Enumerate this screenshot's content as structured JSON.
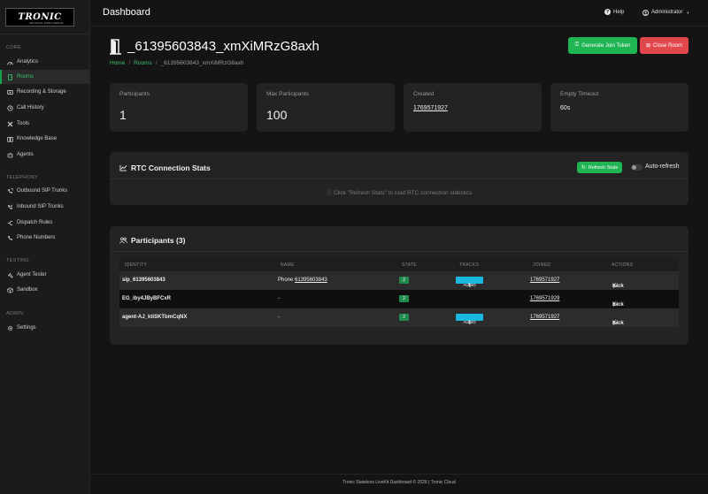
{
  "brand": {
    "logo_text": "TRONIC",
    "logo_sub": "ARTIFICIAL INTELLIGENCE"
  },
  "header": {
    "title": "Dashboard",
    "help_label": "Help",
    "user_label": "Administrator"
  },
  "sidebar": {
    "sections": [
      {
        "title": "CORE",
        "items": [
          {
            "label": "Analytics",
            "icon": "analytics-icon"
          },
          {
            "label": "Rooms",
            "icon": "door-icon",
            "active": true
          },
          {
            "label": "Recording & Storage",
            "icon": "recording-icon"
          },
          {
            "label": "Call History",
            "icon": "history-icon"
          },
          {
            "label": "Tools",
            "icon": "tools-icon"
          },
          {
            "label": "Knowledge Base",
            "icon": "book-icon"
          },
          {
            "label": "Agents",
            "icon": "robot-icon"
          }
        ]
      },
      {
        "title": "TELEPHONY",
        "items": [
          {
            "label": "Outbound SIP Trunks",
            "icon": "phone-outbound-icon"
          },
          {
            "label": "Inbound SIP Trunks",
            "icon": "phone-inbound-icon"
          },
          {
            "label": "Dispatch Rules",
            "icon": "dispatch-icon"
          },
          {
            "label": "Phone Numbers",
            "icon": "phone-icon"
          }
        ]
      },
      {
        "title": "TESTING",
        "items": [
          {
            "label": "Agent Tester",
            "icon": "tester-icon"
          },
          {
            "label": "Sandbox",
            "icon": "sandbox-icon"
          }
        ]
      },
      {
        "title": "ADMIN",
        "items": [
          {
            "label": "Settings",
            "icon": "gear-icon"
          }
        ]
      }
    ]
  },
  "room": {
    "title": "_61395603843_xmXiMRzG8axh",
    "breadcrumb": {
      "home": "Home",
      "rooms": "Rooms",
      "current": "_61395603843_xmXiMRzG8axh"
    },
    "generate_token_label": "Generate Join Token",
    "close_room_label": "Close Room"
  },
  "stats": [
    {
      "label": "Participants",
      "value": "1"
    },
    {
      "label": "Max Participants",
      "value": "100"
    },
    {
      "label": "Created",
      "value": "1769571927"
    },
    {
      "label": "Empty Timeout",
      "value": "60s"
    }
  ],
  "rtc": {
    "title": "RTC Connection Stats",
    "refresh_label": "Refresh Stats",
    "auto_refresh_label": "Auto-refresh",
    "hint": "Click \"Refresh Stats\" to load RTC connection statistics"
  },
  "participants": {
    "title": "Participants (3)",
    "columns": [
      "IDENTITY",
      "NAME",
      "STATE",
      "TRACKS",
      "JOINED",
      "ACTIONS"
    ],
    "rows": [
      {
        "identity": "sip_61395603843",
        "name": "Phone 61395603843",
        "state": "2",
        "track": "AUDIO",
        "joined": "1769571927",
        "action": "Kick"
      },
      {
        "identity": "EG_iby4JByBFCxR",
        "name": "-",
        "state": "2",
        "track": "",
        "joined": "1769571929",
        "action": "Kick"
      },
      {
        "identity": "agent-AJ_ktiSKTbmCqNX",
        "name": "-",
        "state": "2",
        "track": "AUDIO",
        "joined": "1769571927",
        "action": "Kick"
      }
    ]
  },
  "footer": {
    "text": "Tronic Stateless LiveKit Dashboard © 2026 | Tronic Cloud"
  },
  "colors": {
    "accent": "#1fb553",
    "danger": "#e2474b",
    "audio_badge": "#1ab7e0",
    "state_badge": "#1f8b4c"
  }
}
